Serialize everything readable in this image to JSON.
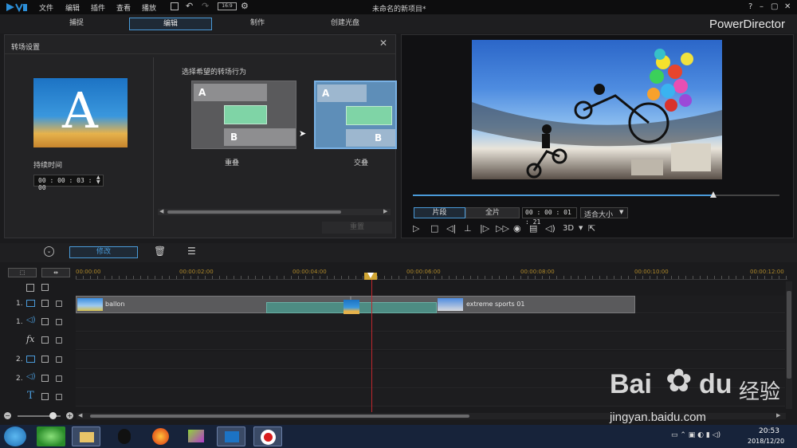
{
  "window": {
    "title": "未命名的新项目*",
    "brand": "PowerDirector"
  },
  "menu": [
    "文件",
    "编辑",
    "插件",
    "查看",
    "播放"
  ],
  "tabs": [
    {
      "label": "捕捉",
      "active": false
    },
    {
      "label": "编辑",
      "active": true
    },
    {
      "label": "制作",
      "active": false
    },
    {
      "label": "创建光盘",
      "active": false
    }
  ],
  "transition_panel": {
    "title": "转场设置",
    "thumb_letter": "A",
    "duration_label": "持续时间",
    "duration_value": "00 : 00 : 03 : 00",
    "behavior_label": "选择希望的转场行为",
    "options": [
      {
        "label": "重叠",
        "a": "A",
        "b": "B",
        "selected": false
      },
      {
        "label": "交叠",
        "a": "A",
        "b": "B",
        "selected": true
      }
    ],
    "reset_button": "重置"
  },
  "preview": {
    "mode_clip": "片段",
    "mode_full": "全片",
    "timecode": "00 : 00 : 01 : 21",
    "fit_label": "适合大小",
    "three_d": "3D",
    "progress": 0.82
  },
  "toolbar": {
    "modify_label": "修改"
  },
  "timeline": {
    "ruler": [
      "00:00:00",
      "00:00:02:00",
      "00:00:04:00",
      "00:00:06:00",
      "00:00:08:00",
      "00:00:10:00",
      "00:00:12:00"
    ],
    "tracks": [
      {
        "num": "1.",
        "type": "video"
      },
      {
        "num": "1.",
        "type": "audio"
      },
      {
        "num": "",
        "type": "fx",
        "symbol": "fx"
      },
      {
        "num": "2.",
        "type": "video"
      },
      {
        "num": "2.",
        "type": "audio"
      },
      {
        "num": "",
        "type": "title",
        "symbol": "T"
      }
    ],
    "clips": [
      {
        "name": "ballon",
        "track": 0
      },
      {
        "name": "extreme sports 01",
        "track": 0
      }
    ]
  },
  "taskbar": {
    "time": "20:53",
    "date": "2018/12/20"
  },
  "watermark": {
    "brand": "Bai",
    "brand2": "du",
    "suffix": "经验",
    "url": "jingyan.baidu.com"
  },
  "colors": {
    "accent": "#4a9ad8",
    "playhead": "#c0272d",
    "clip_green": "#4d8c83",
    "transition_overlay": "#5e8eb8"
  }
}
